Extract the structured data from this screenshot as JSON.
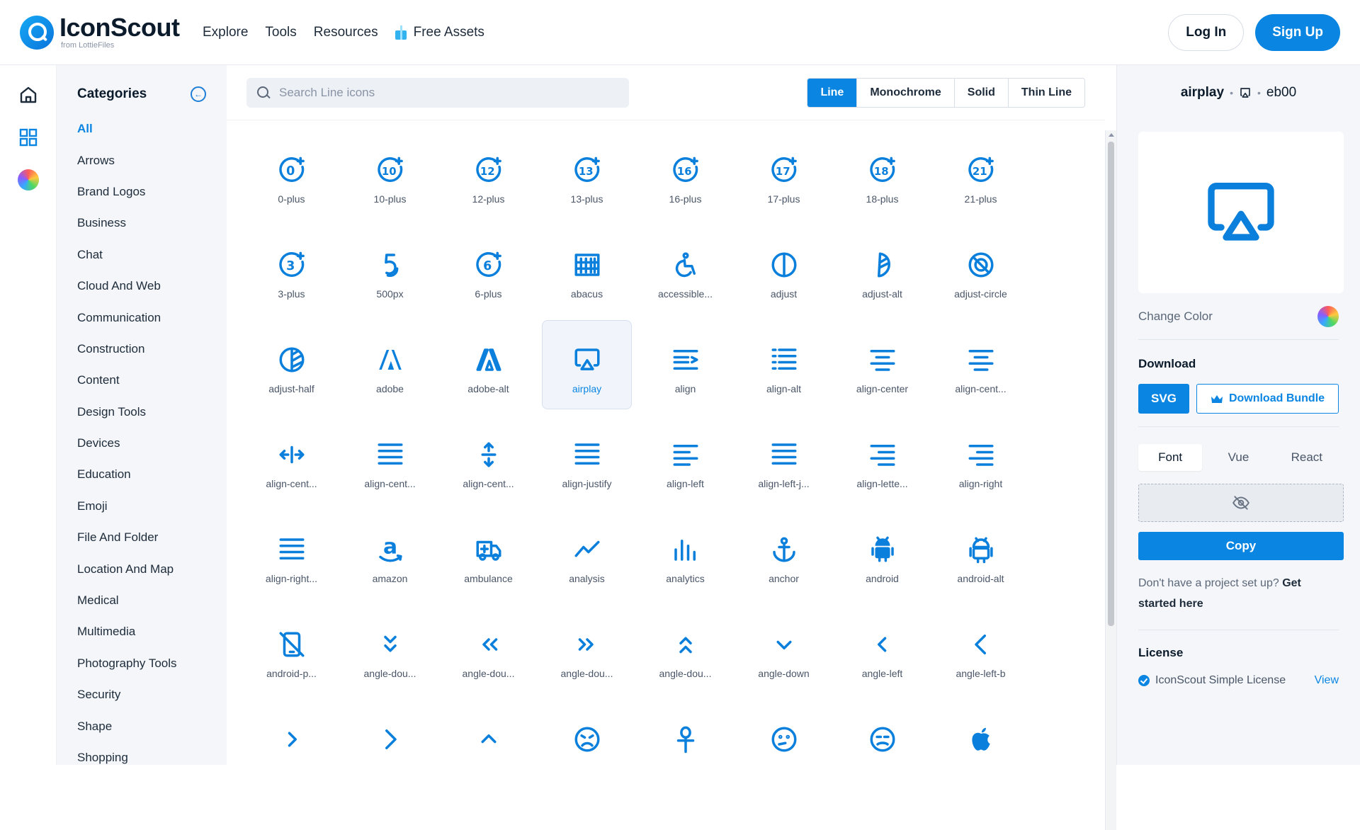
{
  "brand": {
    "name": "IconScout",
    "sub": "from LottieFiles"
  },
  "nav": {
    "explore": "Explore",
    "tools": "Tools",
    "resources": "Resources",
    "free_assets": "Free Assets"
  },
  "auth": {
    "login": "Log In",
    "signup": "Sign Up"
  },
  "rail": {
    "items": [
      "home-icon",
      "grid-icon",
      "palette-icon"
    ]
  },
  "categories": {
    "title": "Categories",
    "items": [
      "All",
      "Arrows",
      "Brand Logos",
      "Business",
      "Chat",
      "Cloud And Web",
      "Communication",
      "Construction",
      "Content",
      "Design Tools",
      "Devices",
      "Education",
      "Emoji",
      "File And Folder",
      "Location And Map",
      "Medical",
      "Multimedia",
      "Photography Tools",
      "Security",
      "Shape",
      "Shopping"
    ],
    "active": "All"
  },
  "search": {
    "placeholder": "Search Line icons",
    "value": ""
  },
  "styles": {
    "tabs": [
      "Line",
      "Monochrome",
      "Solid",
      "Thin Line"
    ],
    "active": "Line"
  },
  "icons": [
    {
      "label": "0-plus",
      "icon": "badge",
      "t": "0"
    },
    {
      "label": "10-plus",
      "icon": "badge",
      "t": "10"
    },
    {
      "label": "12-plus",
      "icon": "badge",
      "t": "12"
    },
    {
      "label": "13-plus",
      "icon": "badge",
      "t": "13"
    },
    {
      "label": "16-plus",
      "icon": "badge",
      "t": "16"
    },
    {
      "label": "17-plus",
      "icon": "badge",
      "t": "17"
    },
    {
      "label": "18-plus",
      "icon": "badge",
      "t": "18"
    },
    {
      "label": "21-plus",
      "icon": "badge",
      "t": "21"
    },
    {
      "label": "3-plus",
      "icon": "badge",
      "t": "3"
    },
    {
      "label": "500px",
      "icon": "fivehundred"
    },
    {
      "label": "6-plus",
      "icon": "badge",
      "t": "6"
    },
    {
      "label": "abacus",
      "icon": "abacus"
    },
    {
      "label": "accessible...",
      "icon": "accessible"
    },
    {
      "label": "adjust",
      "icon": "adjust"
    },
    {
      "label": "adjust-alt",
      "icon": "adjust-alt"
    },
    {
      "label": "adjust-circle",
      "icon": "adjust-circle"
    },
    {
      "label": "adjust-half",
      "icon": "adjust-half"
    },
    {
      "label": "adobe",
      "icon": "adobe"
    },
    {
      "label": "adobe-alt",
      "icon": "adobe-alt"
    },
    {
      "label": "airplay",
      "icon": "airplay",
      "selected": true
    },
    {
      "label": "align",
      "icon": "align"
    },
    {
      "label": "align-alt",
      "icon": "align-alt"
    },
    {
      "label": "align-center",
      "icon": "align-center"
    },
    {
      "label": "align-cent...",
      "icon": "align-center"
    },
    {
      "label": "align-cent...",
      "icon": "align-h-arrows"
    },
    {
      "label": "align-cent...",
      "icon": "lines-full"
    },
    {
      "label": "align-cent...",
      "icon": "align-v-arrows"
    },
    {
      "label": "align-justify",
      "icon": "lines-full"
    },
    {
      "label": "align-left",
      "icon": "align-left"
    },
    {
      "label": "align-left-j...",
      "icon": "lines-full"
    },
    {
      "label": "align-lette...",
      "icon": "align-right"
    },
    {
      "label": "align-right",
      "icon": "align-right"
    },
    {
      "label": "align-right...",
      "icon": "lines-full"
    },
    {
      "label": "amazon",
      "icon": "amazon"
    },
    {
      "label": "ambulance",
      "icon": "ambulance"
    },
    {
      "label": "analysis",
      "icon": "analysis"
    },
    {
      "label": "analytics",
      "icon": "analytics"
    },
    {
      "label": "anchor",
      "icon": "anchor"
    },
    {
      "label": "android",
      "icon": "android"
    },
    {
      "label": "android-alt",
      "icon": "android-alt"
    },
    {
      "label": "android-p...",
      "icon": "android-phone-slash"
    },
    {
      "label": "angle-dou...",
      "icon": "angle-double-down"
    },
    {
      "label": "angle-dou...",
      "icon": "angle-double-left"
    },
    {
      "label": "angle-dou...",
      "icon": "angle-double-right"
    },
    {
      "label": "angle-dou...",
      "icon": "angle-double-up"
    },
    {
      "label": "angle-down",
      "icon": "angle-down"
    },
    {
      "label": "angle-left",
      "icon": "angle-left"
    },
    {
      "label": "angle-left-b",
      "icon": "angle-left-b"
    },
    {
      "label": "",
      "icon": "angle-right"
    },
    {
      "label": "",
      "icon": "angle-right-b"
    },
    {
      "label": "",
      "icon": "angle-up"
    },
    {
      "label": "",
      "icon": "face-angry"
    },
    {
      "label": "",
      "icon": "ankh"
    },
    {
      "label": "",
      "icon": "face-annoyed"
    },
    {
      "label": "",
      "icon": "face-annoyed-alt"
    },
    {
      "label": "",
      "icon": "apple"
    }
  ],
  "detail": {
    "name": "airplay",
    "code": "eb00",
    "change_color": "Change Color",
    "download_title": "Download",
    "svg_button": "SVG",
    "bundle_button": "Download Bundle",
    "code_tabs": [
      "Font",
      "Vue",
      "React"
    ],
    "active_code_tab": "Font",
    "copy_button": "Copy",
    "help_text": "Don't have a project set up? ",
    "help_link": "Get started here",
    "license_title": "License",
    "license_name": "IconScout Simple License",
    "license_view": "View"
  },
  "colors": {
    "accent": "#0a85e2",
    "icon": "#0a7fdc",
    "sidebar_bg": "#f4f6f9"
  }
}
